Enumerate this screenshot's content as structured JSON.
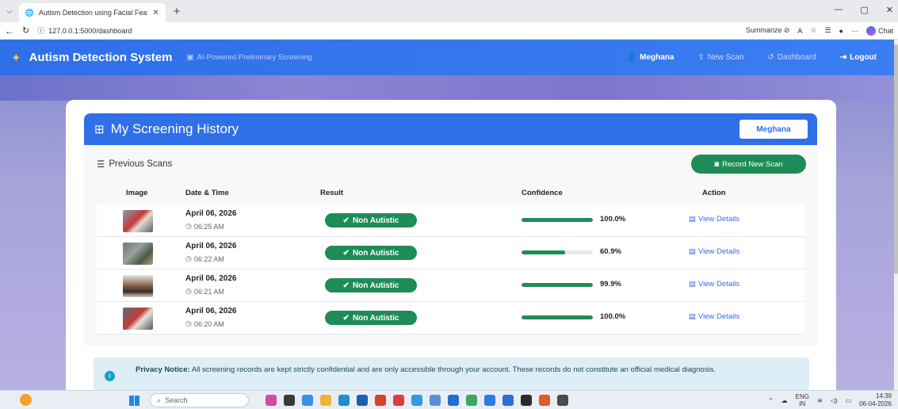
{
  "browser": {
    "tab_title": "Autism Detection using Facial Feat",
    "tab_close": "✕",
    "new_tab": "+",
    "url": "127.0.0.1:5000/dashboard",
    "summarize_label": "Summarize",
    "chat_label": "Chat",
    "window_controls": [
      "—",
      "▢",
      "✕"
    ]
  },
  "navbar": {
    "brand": "Autism Detection System",
    "tagline": "AI-Powered Preliminary Screening",
    "links": {
      "user": "Meghana",
      "new_scan": "New Scan",
      "dashboard": "Dashboard",
      "logout": "Logout"
    }
  },
  "history": {
    "title": "My Screening History",
    "user_pill": "Meghana",
    "section_title": "Previous Scans",
    "record_button": "Record New Scan",
    "columns": [
      "Image",
      "Date & Time",
      "Result",
      "Confidence",
      "Action"
    ],
    "rows": [
      {
        "date": "April 06, 2026",
        "time": "06:25 AM",
        "result": "Non Autistic",
        "confidence": "100.0%",
        "confidence_value": 100.0,
        "action": "View Details"
      },
      {
        "date": "April 06, 2026",
        "time": "06:22 AM",
        "result": "Non Autistic",
        "confidence": "60.9%",
        "confidence_value": 60.9,
        "action": "View Details"
      },
      {
        "date": "April 06, 2026",
        "time": "06:21 AM",
        "result": "Non Autistic",
        "confidence": "99.9%",
        "confidence_value": 99.9,
        "action": "View Details"
      },
      {
        "date": "April 06, 2026",
        "time": "06:20 AM",
        "result": "Non Autistic",
        "confidence": "100.0%",
        "confidence_value": 100.0,
        "action": "View Details"
      }
    ]
  },
  "privacy": {
    "label": "Privacy Notice:",
    "text": "All screening records are kept strictly confidential and are only accessible through your account. These records do not constitute an official medical diagnosis."
  },
  "taskbar": {
    "search_placeholder": "Search",
    "lang_top": "ENG",
    "lang_bottom": "IN",
    "time": "14:39",
    "date": "06-04-2026"
  },
  "colors": {
    "primary": "#2f6fe8",
    "success": "#1e8c56",
    "privacy_bg": "#dceef6"
  }
}
